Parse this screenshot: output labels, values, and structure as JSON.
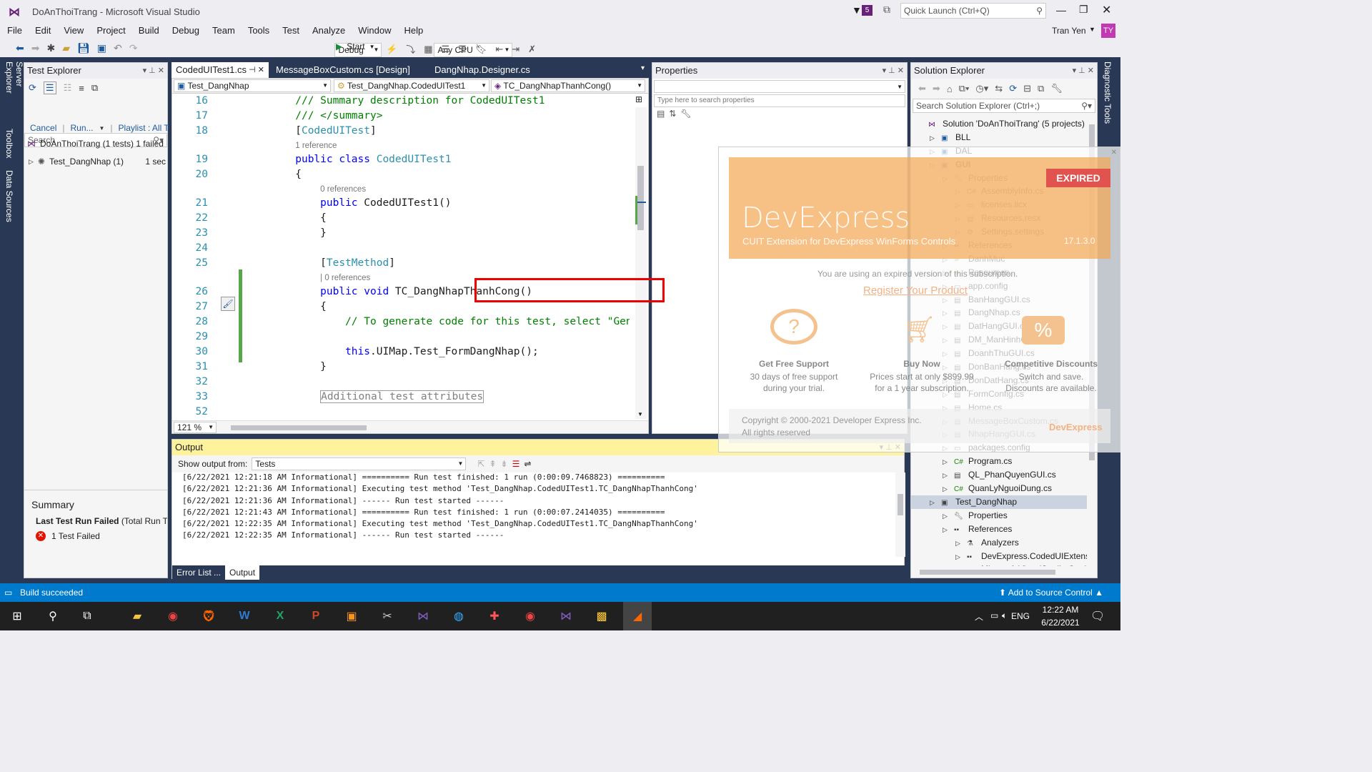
{
  "app": {
    "title": "DoAnThoiTrang - Microsoft Visual Studio",
    "notif_count": "5",
    "quick_launch": "Quick Launch (Ctrl+Q)",
    "user": "Tran Yen",
    "user_initials": "TY"
  },
  "menu": [
    "File",
    "Edit",
    "View",
    "Project",
    "Build",
    "Debug",
    "Team",
    "Tools",
    "Test",
    "Analyze",
    "Window",
    "Help"
  ],
  "toolbar": {
    "config": "Debug",
    "platform": "Any CPU",
    "start": "Start"
  },
  "left_tabs": [
    "Server Explorer",
    "Toolbox",
    "Data Sources"
  ],
  "right_tabs": [
    "Diagnostic Tools"
  ],
  "test_explorer": {
    "title": "Test Explorer",
    "search": "Search",
    "cancel": "Cancel",
    "run": "Run...",
    "playlist": "Playlist : All T",
    "root": "DoAnThoiTrang (1 tests) 1 failed",
    "child": "Test_DangNhap (1)",
    "child_time": "1 sec",
    "summary_title": "Summary",
    "last_run": "Last Test Run Failed",
    "last_run_detail": "(Total Run Tin",
    "failed": "1 Test Failed"
  },
  "editor": {
    "tabs": [
      "CodedUITest1.cs",
      "MessageBoxCustom.cs [Design]",
      "DangNhap.Designer.cs"
    ],
    "nav": [
      "Test_DangNhap",
      "Test_DangNhap.CodedUITest1",
      "TC_DangNhapThanhCong()"
    ],
    "zoom": "121 %",
    "lines": [
      {
        "n": "16",
        "parts": [
          [
            "cm",
            "    /// Summary description for CodedUITest1"
          ]
        ]
      },
      {
        "n": "17",
        "parts": [
          [
            "cm",
            "    /// </summary>"
          ]
        ]
      },
      {
        "n": "18",
        "parts": [
          [
            "t",
            "    ["
          ],
          [
            "cls",
            "CodedUITest"
          ],
          [
            "t",
            "]"
          ]
        ]
      },
      {
        "n": "",
        "ref": "1 reference",
        "indent": "    "
      },
      {
        "n": "19",
        "parts": [
          [
            "kw",
            "    public class "
          ],
          [
            "cls",
            "CodedUITest1"
          ]
        ]
      },
      {
        "n": "20",
        "parts": [
          [
            "t",
            "    {"
          ]
        ]
      },
      {
        "n": "",
        "ref": "0 references",
        "indent": "        "
      },
      {
        "n": "21",
        "parts": [
          [
            "kw",
            "        public "
          ],
          [
            "t",
            "CodedUITest1()"
          ]
        ]
      },
      {
        "n": "22",
        "parts": [
          [
            "t",
            "        {"
          ]
        ]
      },
      {
        "n": "23",
        "parts": [
          [
            "t",
            "        }"
          ]
        ]
      },
      {
        "n": "24",
        "parts": [
          [
            "t",
            ""
          ]
        ]
      },
      {
        "n": "25",
        "parts": [
          [
            "t",
            "        ["
          ],
          [
            "cls",
            "TestMethod"
          ],
          [
            "t",
            "]"
          ]
        ]
      },
      {
        "n": "",
        "ref": "| 0 references",
        "indent": "        "
      },
      {
        "n": "26",
        "parts": [
          [
            "kw",
            "        public void "
          ],
          [
            "t",
            "TC_DangNhapThanhCong()"
          ]
        ]
      },
      {
        "n": "27",
        "parts": [
          [
            "t",
            "        {"
          ]
        ]
      },
      {
        "n": "28",
        "parts": [
          [
            "cm",
            "            // To generate code for this test, select \"Gener"
          ]
        ]
      },
      {
        "n": "29",
        "parts": [
          [
            "t",
            ""
          ]
        ]
      },
      {
        "n": "30",
        "parts": [
          [
            "kw",
            "            this"
          ],
          [
            "t",
            ".UIMap.Test_FormDangNhap();"
          ]
        ]
      },
      {
        "n": "31",
        "parts": [
          [
            "t",
            "        }"
          ]
        ]
      },
      {
        "n": "32",
        "parts": [
          [
            "t",
            ""
          ]
        ]
      },
      {
        "n": "33",
        "parts": [
          [
            "t",
            "        "
          ],
          [
            "gr",
            "Additional test attributes"
          ]
        ]
      },
      {
        "n": "52",
        "parts": [
          [
            "t",
            ""
          ]
        ]
      }
    ]
  },
  "properties": {
    "title": "Properties",
    "search": "Type here to search properties"
  },
  "solution_explorer": {
    "title": "Solution Explorer",
    "search": "Search Solution Explorer (Ctrl+;)",
    "items": [
      {
        "label": "Solution 'DoAnThoiTrang' (5 projects)",
        "indent": 0,
        "icon": "solution-icon"
      },
      {
        "label": "BLL",
        "indent": 1,
        "icon": "csproj-icon"
      },
      {
        "label": "DAL",
        "indent": 1,
        "icon": "csproj-icon"
      },
      {
        "label": "GUI",
        "indent": 1,
        "icon": "csproj-icon",
        "bold": true
      },
      {
        "label": "Properties",
        "indent": 2,
        "icon": "wrench-icon"
      },
      {
        "label": "AssemblyInfo.cs",
        "indent": 3,
        "icon": "cs-file-icon"
      },
      {
        "label": "licenses.licx",
        "indent": 3,
        "icon": "file-icon"
      },
      {
        "label": "Resources.resx",
        "indent": 3,
        "icon": "resx-icon"
      },
      {
        "label": "Settings.settings",
        "indent": 3,
        "icon": "settings-icon"
      },
      {
        "label": "References",
        "indent": 2,
        "icon": "references-icon"
      },
      {
        "label": "DanhMuc",
        "indent": 2,
        "icon": "folder-icon"
      },
      {
        "label": "Resources",
        "indent": 2,
        "icon": "folder-icon"
      },
      {
        "label": "app.config",
        "indent": 2,
        "icon": "file-icon"
      },
      {
        "label": "BanHangGUI.cs",
        "indent": 2,
        "icon": "form-icon"
      },
      {
        "label": "DangNhap.cs",
        "indent": 2,
        "icon": "form-icon"
      },
      {
        "label": "DatHangGUI.cs",
        "indent": 2,
        "icon": "form-icon"
      },
      {
        "label": "DM_ManHinhGUI.cs",
        "indent": 2,
        "icon": "form-icon"
      },
      {
        "label": "DoanhThuGUI.cs",
        "indent": 2,
        "icon": "form-icon"
      },
      {
        "label": "DonBanHang.cs",
        "indent": 2,
        "icon": "form-icon"
      },
      {
        "label": "DonDatHang.cs",
        "indent": 2,
        "icon": "form-icon"
      },
      {
        "label": "FormConfig.cs",
        "indent": 2,
        "icon": "form-icon"
      },
      {
        "label": "Home.cs",
        "indent": 2,
        "icon": "form-icon"
      },
      {
        "label": "MessageBoxCustom.cs",
        "indent": 2,
        "icon": "form-icon"
      },
      {
        "label": "NhapHangGUI.cs",
        "indent": 2,
        "icon": "form-icon"
      },
      {
        "label": "packages.config",
        "indent": 2,
        "icon": "file-icon"
      },
      {
        "label": "Program.cs",
        "indent": 2,
        "icon": "cs-file-icon"
      },
      {
        "label": "QL_PhanQuyenGUI.cs",
        "indent": 2,
        "icon": "form-icon"
      },
      {
        "label": "QuanLyNguoiDung.cs",
        "indent": 2,
        "icon": "cs-file-icon"
      },
      {
        "label": "Test_DangNhap",
        "indent": 1,
        "icon": "test-project-icon",
        "selected": true
      },
      {
        "label": "Properties",
        "indent": 2,
        "icon": "wrench-icon"
      },
      {
        "label": "References",
        "indent": 2,
        "icon": "references-icon"
      },
      {
        "label": "Analyzers",
        "indent": 3,
        "icon": "analyzer-icon"
      },
      {
        "label": "DevExpress.CodedUIExtensic",
        "indent": 3,
        "icon": "reference-icon"
      },
      {
        "label": "Microsoft.VisualStudio.Quali",
        "indent": 3,
        "icon": "reference-icon"
      }
    ]
  },
  "output": {
    "title": "Output",
    "show_from": "Show output from:",
    "source": "Tests",
    "lines": [
      "[6/22/2021 12:21:18 AM Informational] ========== Run test finished: 1 run (0:00:09.7468823) ==========",
      "[6/22/2021 12:21:36 AM Informational] Executing test method 'Test_DangNhap.CodedUITest1.TC_DangNhapThanhCong'",
      "[6/22/2021 12:21:36 AM Informational] ------ Run test started ------",
      "[6/22/2021 12:21:43 AM Informational] ========== Run test finished: 1 run (0:00:07.2414035) ==========",
      "[6/22/2021 12:22:35 AM Informational] Executing test method 'Test_DangNhap.CodedUITest1.TC_DangNhapThanhCong'",
      "[6/22/2021 12:22:35 AM Informational] ------ Run test started ------"
    ],
    "bottom_tabs": [
      "Error List ...",
      "Output"
    ]
  },
  "devexpress": {
    "badge": "EXPIRED",
    "brand": "DevExpress",
    "subtitle": "CUIT Extension for DevExpress WinForms Controls",
    "version": "17.1.3.0",
    "expired_msg": "You are using an expired version of this subscription.",
    "register": "Register Your Product",
    "support_title": "Get Free Support",
    "support_desc1": "30 days of free support",
    "support_desc2": "during your trial.",
    "buy_title": "Buy Now",
    "buy_desc1": "Prices start at only $899.99",
    "buy_desc2": "for a 1 year subscription.",
    "disc_title": "Competitive Discounts",
    "disc_desc1": "Switch and save.",
    "disc_desc2": "Discounts are available.",
    "copyright1": "Copyright © 2000-2021 Developer Express Inc.",
    "copyright2": "All rights reserved",
    "logo": "DevExpress"
  },
  "status": {
    "left": "Build succeeded",
    "right": "Add to Source Control"
  },
  "taskbar": {
    "lang": "ENG",
    "time": "12:22 AM",
    "date": "6/22/2021"
  }
}
